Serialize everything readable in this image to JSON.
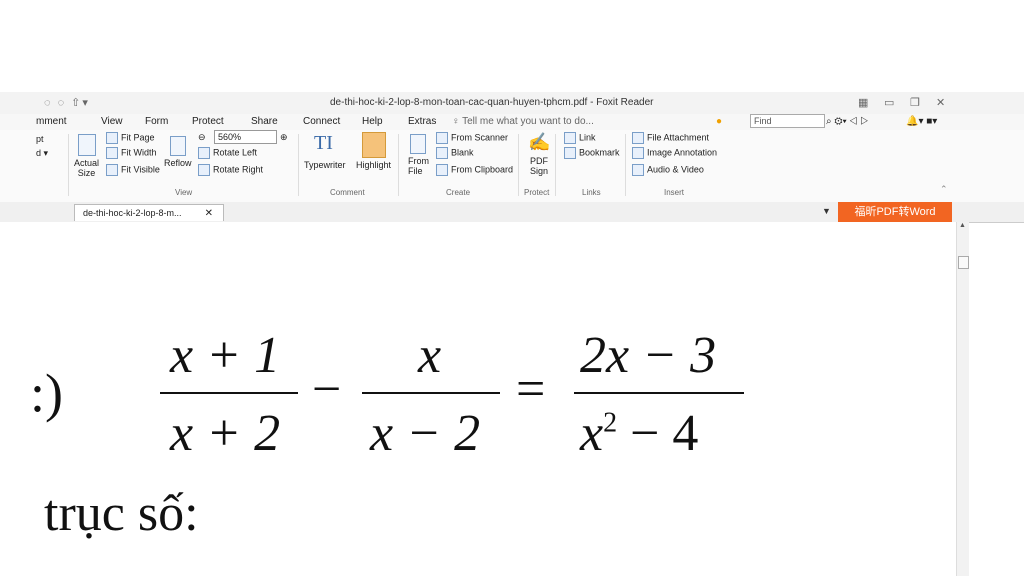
{
  "window": {
    "title": "de-thi-hoc-ki-2-lop-8-mon-toan-cac-quan-huyen-tphcm.pdf - Foxit Reader"
  },
  "menu": {
    "items": [
      "mment",
      "View",
      "Form",
      "Protect",
      "Share",
      "Connect",
      "Help",
      "Extras"
    ],
    "tell_me": "Tell me what you want to do...",
    "find_placeholder": "Find"
  },
  "ribbon": {
    "left_partial": [
      "pt",
      "d ▾"
    ],
    "actual_size": "Actual\nSize",
    "fit_page": "Fit Page",
    "fit_width": "Fit Width",
    "fit_visible": "Fit Visible",
    "reflow": "Reflow",
    "zoom": "560%",
    "rotate_left": "Rotate Left",
    "rotate_right": "Rotate Right",
    "typewriter": "Typewriter",
    "highlight": "Highlight",
    "from_file": "From\nFile",
    "from_scanner": "From Scanner",
    "blank": "Blank",
    "from_clipboard": "From Clipboard",
    "pdf_sign": "PDF\nSign",
    "link": "Link",
    "bookmark": "Bookmark",
    "file_attachment": "File Attachment",
    "image_annotation": "Image Annotation",
    "audio_video": "Audio & Video",
    "groups": {
      "view": "View",
      "comment": "Comment",
      "create": "Create",
      "protect": "Protect",
      "links": "Links",
      "insert": "Insert"
    }
  },
  "tabs": {
    "doc_tab": "de-thi-hoc-ki-2-lop-8-m...",
    "promo": "福昕PDF转Word"
  },
  "document": {
    "label_c": ":)",
    "n1": "x + 1",
    "d1": "x + 2",
    "minus": "−",
    "n2": "x",
    "d2": "x − 2",
    "equals": "=",
    "n3": "2x − 3",
    "d3_base": "x",
    "d3_exp": "2",
    "d3_rest": " − 4",
    "text": "trục số:"
  }
}
